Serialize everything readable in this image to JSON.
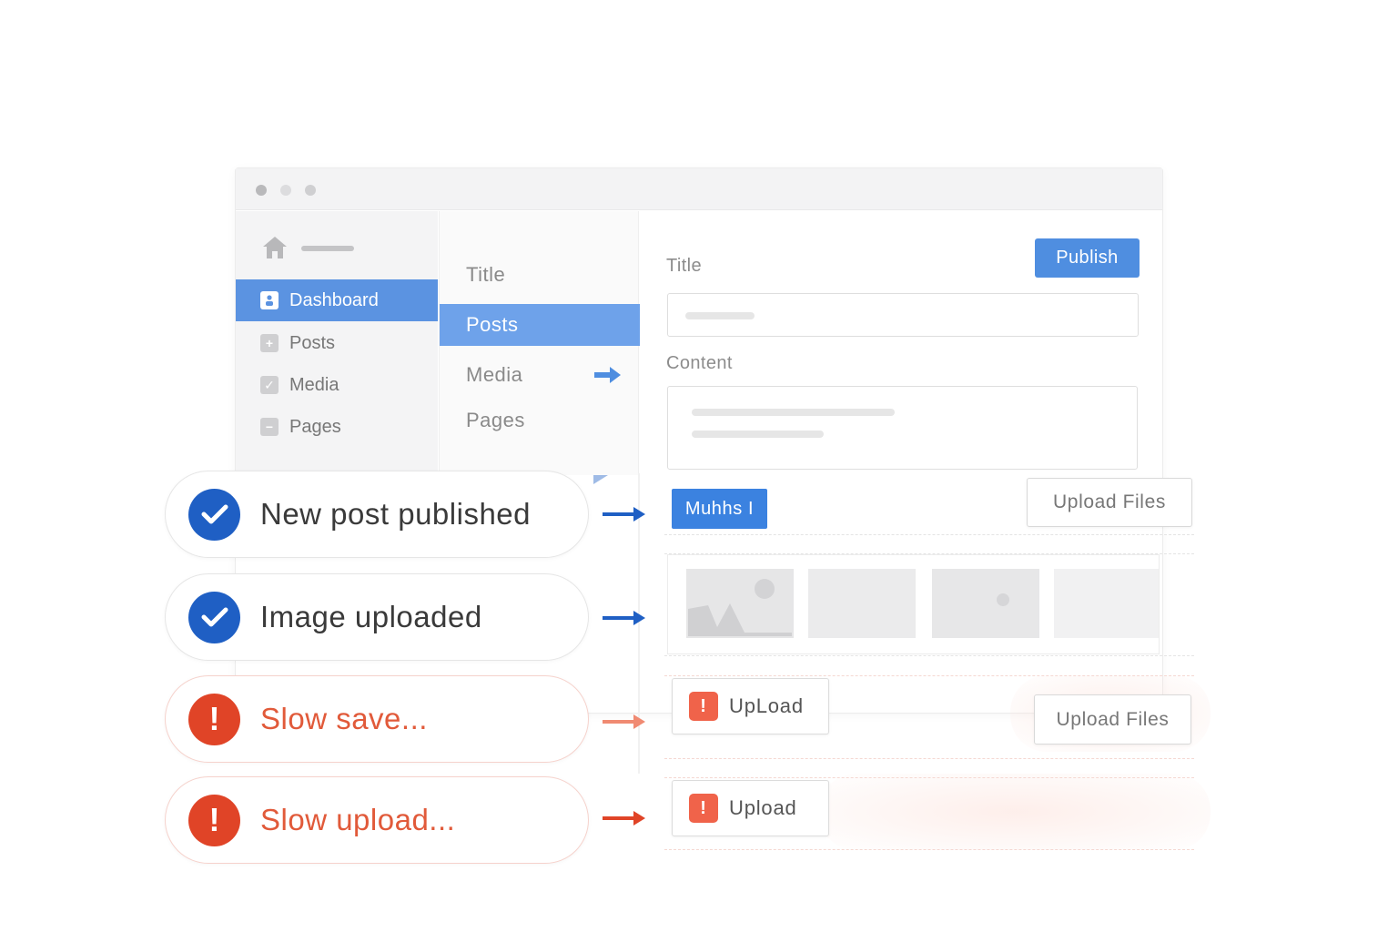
{
  "window": {
    "sidebar": {
      "items": [
        {
          "label": "Dashboard",
          "icon": "user-icon",
          "active": true
        },
        {
          "label": "Posts",
          "icon": "plus-icon",
          "active": false
        },
        {
          "label": "Media",
          "icon": "check-icon",
          "active": false
        },
        {
          "label": "Pages",
          "icon": "minus-icon",
          "active": false
        }
      ]
    },
    "middle": {
      "items": [
        {
          "label": "Title",
          "active": false
        },
        {
          "label": "Posts",
          "active": true
        },
        {
          "label": "Media",
          "active": false
        },
        {
          "label": "Pages",
          "active": false
        }
      ]
    },
    "editor": {
      "title_label": "Title",
      "content_label": "Content",
      "publish_label": "Publish"
    }
  },
  "notifications": [
    {
      "message": "New post published",
      "status": "success",
      "icon": "checkmark-icon"
    },
    {
      "message": "Image uploaded",
      "status": "success",
      "icon": "checkmark-icon"
    },
    {
      "message": "Slow save...",
      "status": "warning",
      "icon": "exclamation-icon"
    },
    {
      "message": "Slow upload...",
      "status": "warning",
      "icon": "exclamation-icon"
    }
  ],
  "controls": {
    "blue_chip_label": "Muhhs I",
    "upload_files_label_1": "Upload Files",
    "upload_label_1": "UpLoad",
    "upload_files_label_2": "Upload Files",
    "upload_label_2": "Upload"
  },
  "colors": {
    "accent_blue": "#5b93e1",
    "success_blue": "#1f5fc4",
    "error_red": "#e04427",
    "error_text": "#e15a3a"
  }
}
